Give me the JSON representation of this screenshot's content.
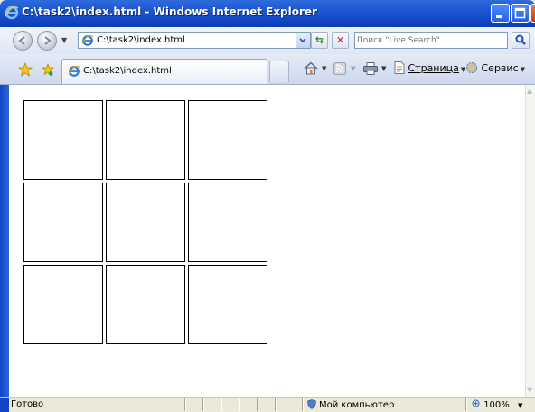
{
  "window": {
    "title": "C:\\task2\\index.html - Windows Internet Explorer"
  },
  "address_bar": {
    "url": "C:\\task2\\index.html"
  },
  "search": {
    "placeholder": "Поиск \"Live Search\""
  },
  "tab": {
    "label": "C:\\task2\\index.html"
  },
  "commands": {
    "page": "Страница",
    "service": "Сервис"
  },
  "status_bar": {
    "status": "Готово",
    "zone": "Мой компьютер",
    "zoom": "100%"
  },
  "grid": {
    "rows": 3,
    "columns": 3
  },
  "icons": [
    "ie-logo-icon",
    "back-icon",
    "forward-icon",
    "refresh-icon",
    "stop-icon",
    "search-icon",
    "favorites-star-icon",
    "add-favorites-icon",
    "home-icon",
    "feeds-icon",
    "print-icon",
    "page-icon",
    "tools-gear-icon",
    "computer-zone-icon",
    "zoom-icon"
  ]
}
